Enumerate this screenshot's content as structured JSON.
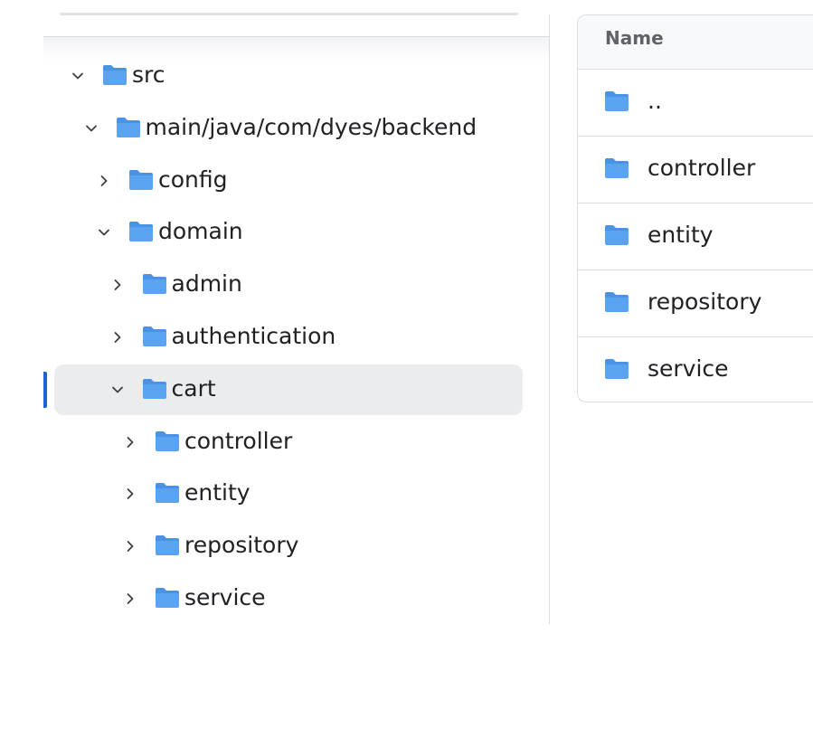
{
  "tree": {
    "items": [
      {
        "label": "src",
        "expanded": true,
        "level": 0
      },
      {
        "label": "main/java/com/dyes/backend",
        "expanded": true,
        "level": 1
      },
      {
        "label": "config",
        "expanded": false,
        "level": 2
      },
      {
        "label": "domain",
        "expanded": true,
        "level": 2
      },
      {
        "label": "admin",
        "expanded": false,
        "level": 3
      },
      {
        "label": "authentication",
        "expanded": false,
        "level": 3
      },
      {
        "label": "cart",
        "expanded": true,
        "level": 3,
        "selected": true
      },
      {
        "label": "controller",
        "expanded": false,
        "level": 4
      },
      {
        "label": "entity",
        "expanded": false,
        "level": 4
      },
      {
        "label": "repository",
        "expanded": false,
        "level": 4
      },
      {
        "label": "service",
        "expanded": false,
        "level": 4
      }
    ]
  },
  "file_list": {
    "header": {
      "name_label": "Name"
    },
    "rows": [
      {
        "label": ".."
      },
      {
        "label": "controller"
      },
      {
        "label": "entity"
      },
      {
        "label": "repository"
      },
      {
        "label": "service"
      }
    ]
  },
  "colors": {
    "folder": "#5aa3f0",
    "folder_tab": "#4a92e4",
    "selected_row": "#ebecee",
    "selection_indicator": "#1a63d6"
  },
  "icons": {
    "folder": "folder-icon",
    "chevron_down": "chevron-down-icon",
    "chevron_right": "chevron-right-icon"
  }
}
